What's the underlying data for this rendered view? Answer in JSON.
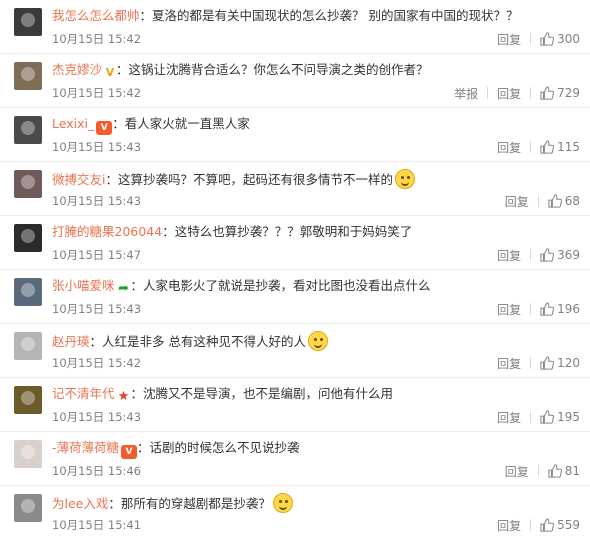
{
  "ui": {
    "reply_label": "回复",
    "report_label": "举报"
  },
  "comments": [
    {
      "nick": "我怎么怎么都帅",
      "sep": "：",
      "text": "夏洛的都是有关中国现状的怎么抄袭？ 别的国家有中国的现状？？",
      "time": "10月15日 15:42",
      "likes": "300",
      "avatar_color": "#3b3b3b"
    },
    {
      "nick": "杰克嫪沙",
      "sep": "：",
      "text": "这锅让沈腾背合适么？你怎么不问导演之类的创作者？",
      "time": "10月15日 15:42",
      "likes": "729",
      "avatar_color": "#7e6d57"
    },
    {
      "nick": "Lexixi_",
      "sep": "：",
      "text": "看人家火就一直黑人家",
      "time": "10月15日 15:43",
      "likes": "115",
      "avatar_color": "#4a4a4a"
    },
    {
      "nick": "微搏交友i",
      "sep": "：",
      "text": "这算抄袭吗？不算吧，起码还有很多情节不一样的",
      "time": "10月15日 15:43",
      "likes": "68",
      "avatar_color": "#6e5b5b"
    },
    {
      "nick": "打腌的糖果206044",
      "sep": "：",
      "text": "这特么也算抄袭？？？郭敬明和于妈妈笑了",
      "time": "10月15日 15:47",
      "likes": "369",
      "avatar_color": "#2b2b2b"
    },
    {
      "nick": "张小喵爱咪",
      "sep": "：",
      "text": "人家电影火了就说是抄袭，看对比图也没看出点什么",
      "time": "10月15日 15:43",
      "likes": "196",
      "avatar_color": "#5b6a7a"
    },
    {
      "nick": "赵丹瑛",
      "sep": "：",
      "text": "人红是非多 总有这种见不得人好的人",
      "time": "10月15日 15:42",
      "likes": "120",
      "avatar_color": "#b5b5b5"
    },
    {
      "nick": "记不清年代",
      "sep": "：",
      "text": "沈腾又不是导演，也不是编剧，问他有什么用",
      "time": "10月15日 15:43",
      "likes": "195",
      "avatar_color": "#6b5a2a"
    },
    {
      "nick": "-薄荷薄荷糖",
      "sep": "：",
      "text": "话剧的时候怎么不见说抄袭",
      "time": "10月15日 15:46",
      "likes": "81",
      "avatar_color": "#d9d0cc"
    },
    {
      "nick": "为lee入戏",
      "sep": "：",
      "text": "那所有的穿越剧都是抄袭？",
      "time": "10月15日 15:41",
      "likes": "559",
      "avatar_color": "#8a8a8a"
    }
  ]
}
